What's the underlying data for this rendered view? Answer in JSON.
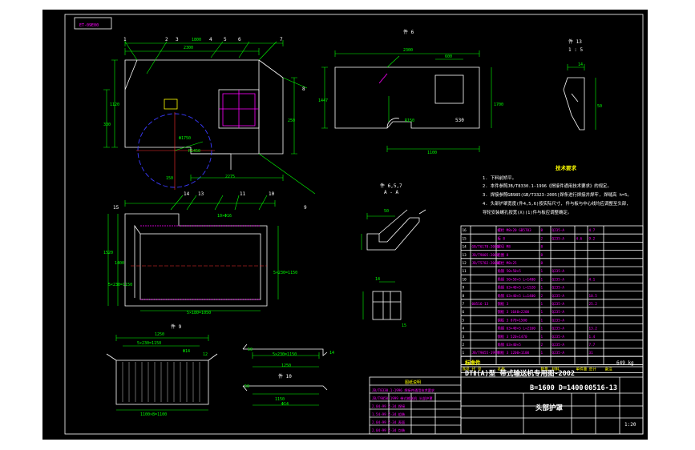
{
  "drawing": {
    "code_box": "ET-09E00",
    "frame_title": "DTⅡ(A)型  带式输送机专用图-2002",
    "spec": "B=1600  D=1400",
    "drawing_no": "00516-13",
    "part_name": "头部护罩",
    "scale": "1:20",
    "weight": "649 kg"
  },
  "views": {
    "view_a": "件 6",
    "view_b": "件 13",
    "view_b_scale": "1 : 5",
    "section_aa": "A - A",
    "section_aa_scale": "件 6,5,7",
    "view_8": "件 8",
    "view_10": "件 10",
    "view_9": "件 9",
    "view_11": "件 11"
  },
  "notes": {
    "title": "技术要求",
    "items": [
      "1. 下料前矫平。",
      "2. 本件参照JB/T8330.1-1996《焊接件通用技术要求》的规定。",
      "3. 焊接参照GB985(GB/T3323-2005)焊条进行焊接并焊牢, 焊缝高 h=5。",
      "4. 头部护罩宽度(件4,5,6)按实际尺寸, 件与板与中心线均应调整至头部,",
      "   导轮安装螺孔按宽(X)(1)件与板应调整确定。"
    ]
  },
  "labels": {
    "balloons": [
      "1",
      "2",
      "3",
      "4",
      "5",
      "6",
      "7",
      "8",
      "9",
      "10",
      "11",
      "12",
      "13",
      "14",
      "15",
      "16"
    ],
    "dims_main": [
      "2300",
      "1800",
      "1100",
      "1120",
      "330",
      "250",
      "170",
      "1250",
      "1520",
      "Φ1750",
      "R1450",
      "150",
      "2275",
      "1760",
      "470",
      "1350"
    ],
    "dims_view6": [
      "2300",
      "600",
      "1447",
      "1700",
      "1100",
      "700",
      "530",
      "720",
      "R150"
    ],
    "dims_plan": [
      "1400",
      "1520",
      "5×230=1150",
      "5×180=1050",
      "5×230=1150",
      "850",
      "1620",
      "M2",
      "M8",
      "10×Φ16"
    ],
    "dims_small": [
      "1250",
      "5×230=1150",
      "1100×8=1100",
      "1250",
      "5×230=1150",
      "1150",
      "14",
      "Φ14",
      "15",
      "50",
      "12"
    ]
  },
  "bom": {
    "header": [
      "序号",
      "代  号",
      "名称",
      "数量",
      "材料",
      "单件重",
      "总计",
      "备注"
    ],
    "rows": [
      [
        "16",
        "",
        "螺栓 M8×20 GB5783",
        "8",
        "Q235-A",
        "",
        "4.7",
        ""
      ],
      [
        "15",
        "",
        "板 8",
        "2",
        "Q235-A",
        "4.6",
        "9.2",
        ""
      ],
      [
        "14",
        "GB/T6170-2000",
        "螺母 M8",
        "8",
        "",
        "",
        "",
        ""
      ],
      [
        "13",
        "JB/T9005-2000",
        "垫圈 8",
        "8",
        "",
        "",
        "",
        ""
      ],
      [
        "12",
        "JB/T5782-2000",
        "螺栓 M8×25",
        "8",
        "",
        "",
        "",
        ""
      ],
      [
        "11",
        "",
        "角钢 50×50×5",
        "1",
        "Q235-A",
        "",
        "",
        ""
      ],
      [
        "10",
        "",
        "角钢 50×50×5 L=1400",
        "1",
        "Q235-A",
        "",
        "4.1",
        ""
      ],
      [
        "9",
        "",
        "角钢 63×40×5 L=1520",
        "1",
        "Q235-A",
        "",
        "",
        ""
      ],
      [
        "8",
        "",
        "角钢 63×40×5 L=1400",
        "2",
        "Q235-A",
        "",
        "10.5",
        ""
      ],
      [
        "7",
        "00516-13",
        "钢板 3",
        "1",
        "Q235-A",
        "",
        "25.2",
        ""
      ],
      [
        "6",
        "",
        "钢板 3 1640×2200",
        "1",
        "Q235-A",
        "",
        "",
        ""
      ],
      [
        "5",
        "",
        "钢板 3 870×1500",
        "1",
        "Q235-A",
        "",
        "",
        ""
      ],
      [
        "4",
        "",
        "角钢 63×40×5 L=2160",
        "1",
        "Q235-A",
        "",
        "13.2",
        ""
      ],
      [
        "3",
        "",
        "钢板 3 520×1470",
        "1",
        "Q235-A",
        "",
        "1.4",
        ""
      ],
      [
        "2",
        "",
        "角钢 63×40×5",
        "2",
        "Q235-A",
        "",
        "7.7",
        ""
      ],
      [
        "1",
        "JB/T9055-1999",
        "钢板 3 1200×1100",
        "1",
        "Q235-A",
        "",
        "31",
        ""
      ]
    ],
    "footer_left": "标准件",
    "footer_total": "649 kg"
  },
  "revision_table": {
    "title": "图纸说明",
    "rows": [
      "JB/T8330.1-1996 焊接件通用技术要求",
      "JB/T9050-1999 带式输送机 头部护罩",
      "2.04-99 Z-34 焊接",
      "1.54-99 Z-34 组装",
      "2.04-99 Z-34 表面",
      "2.04-99 Z-34 包装"
    ]
  }
}
